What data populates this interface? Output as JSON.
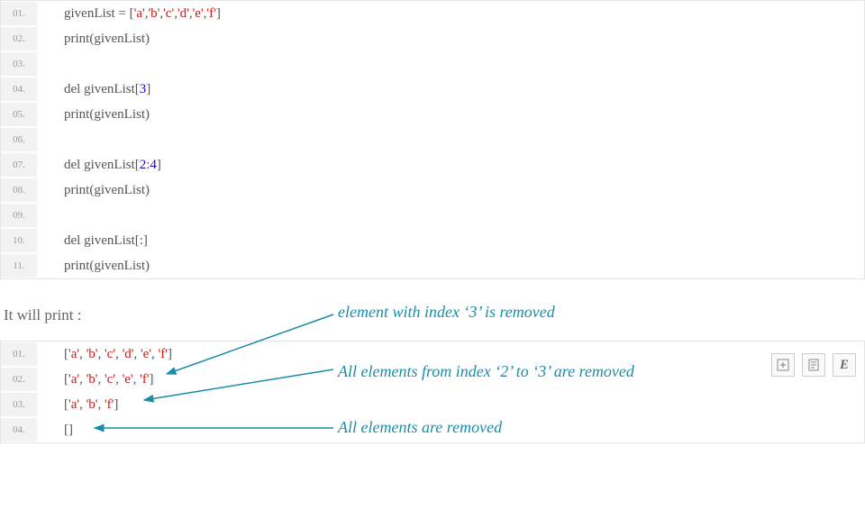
{
  "code_block_1": {
    "lines": [
      {
        "n": "01.",
        "segments": [
          {
            "t": "givenList = [",
            "c": ""
          },
          {
            "t": "'a'",
            "c": "str"
          },
          {
            "t": ",",
            "c": ""
          },
          {
            "t": "'b'",
            "c": "str"
          },
          {
            "t": ",",
            "c": ""
          },
          {
            "t": "'c'",
            "c": "str"
          },
          {
            "t": ",",
            "c": ""
          },
          {
            "t": "'d'",
            "c": "str"
          },
          {
            "t": ",",
            "c": ""
          },
          {
            "t": "'e'",
            "c": "str"
          },
          {
            "t": ",",
            "c": ""
          },
          {
            "t": "'f'",
            "c": "str"
          },
          {
            "t": "]",
            "c": ""
          }
        ]
      },
      {
        "n": "02.",
        "segments": [
          {
            "t": "print(givenList)",
            "c": ""
          }
        ]
      },
      {
        "n": "03.",
        "segments": []
      },
      {
        "n": "04.",
        "segments": [
          {
            "t": "del givenList[",
            "c": ""
          },
          {
            "t": "3",
            "c": "num"
          },
          {
            "t": "]",
            "c": ""
          }
        ]
      },
      {
        "n": "05.",
        "segments": [
          {
            "t": "print(givenList)",
            "c": ""
          }
        ]
      },
      {
        "n": "06.",
        "segments": []
      },
      {
        "n": "07.",
        "segments": [
          {
            "t": "del givenList[",
            "c": ""
          },
          {
            "t": "2",
            "c": "num"
          },
          {
            "t": ":",
            "c": ""
          },
          {
            "t": "4",
            "c": "num"
          },
          {
            "t": "]",
            "c": ""
          }
        ]
      },
      {
        "n": "08.",
        "segments": [
          {
            "t": "print(givenList)",
            "c": ""
          }
        ]
      },
      {
        "n": "09.",
        "segments": []
      },
      {
        "n": "10.",
        "segments": [
          {
            "t": "del givenList[:]",
            "c": ""
          }
        ]
      },
      {
        "n": "11.",
        "segments": [
          {
            "t": "print(givenList)",
            "c": ""
          }
        ]
      }
    ]
  },
  "prose_text": "It will print :",
  "code_block_2": {
    "lines": [
      {
        "n": "01.",
        "segments": [
          {
            "t": "[",
            "c": ""
          },
          {
            "t": "'a'",
            "c": "str"
          },
          {
            "t": ", ",
            "c": ""
          },
          {
            "t": "'b'",
            "c": "str"
          },
          {
            "t": ", ",
            "c": ""
          },
          {
            "t": "'c'",
            "c": "str"
          },
          {
            "t": ", ",
            "c": ""
          },
          {
            "t": "'d'",
            "c": "str"
          },
          {
            "t": ", ",
            "c": ""
          },
          {
            "t": "'e'",
            "c": "str"
          },
          {
            "t": ", ",
            "c": ""
          },
          {
            "t": "'f'",
            "c": "str"
          },
          {
            "t": "]",
            "c": ""
          }
        ]
      },
      {
        "n": "02.",
        "segments": [
          {
            "t": "[",
            "c": ""
          },
          {
            "t": "'a'",
            "c": "str"
          },
          {
            "t": ", ",
            "c": ""
          },
          {
            "t": "'b'",
            "c": "str"
          },
          {
            "t": ", ",
            "c": ""
          },
          {
            "t": "'c'",
            "c": "str"
          },
          {
            "t": ", ",
            "c": ""
          },
          {
            "t": "'e'",
            "c": "str"
          },
          {
            "t": ", ",
            "c": ""
          },
          {
            "t": "'f'",
            "c": "str"
          },
          {
            "t": "]",
            "c": ""
          }
        ]
      },
      {
        "n": "03.",
        "segments": [
          {
            "t": "[",
            "c": ""
          },
          {
            "t": "'a'",
            "c": "str"
          },
          {
            "t": ", ",
            "c": ""
          },
          {
            "t": "'b'",
            "c": "str"
          },
          {
            "t": ", ",
            "c": ""
          },
          {
            "t": "'f'",
            "c": "str"
          },
          {
            "t": "]",
            "c": ""
          }
        ]
      },
      {
        "n": "04.",
        "segments": [
          {
            "t": "[]",
            "c": ""
          }
        ]
      }
    ]
  },
  "annotations": {
    "a1": "element with index ‘3’ is removed",
    "a2": "All elements from index ‘2’ to ‘3’ are removed",
    "a3": "All elements are removed"
  },
  "toolbar": {
    "btn1": "plus",
    "btn2": "doc",
    "btn3": "E"
  }
}
